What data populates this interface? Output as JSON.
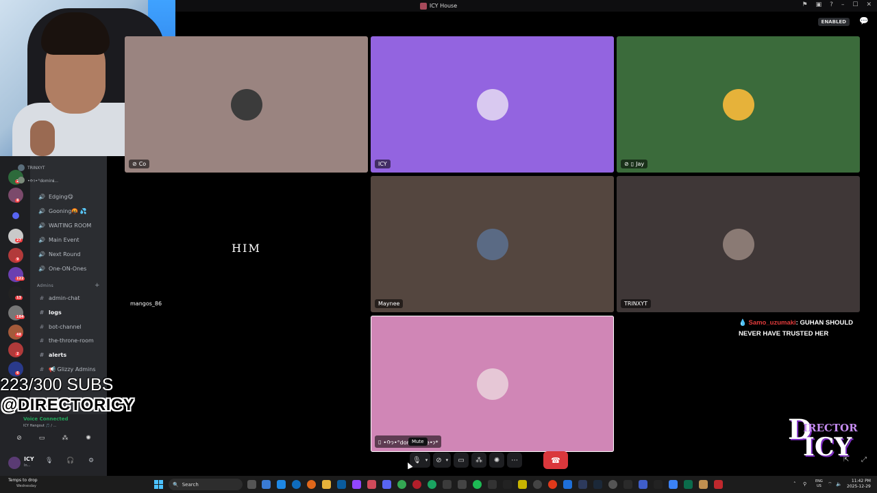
{
  "window": {
    "title": "ICY House",
    "enabled_badge": "ENABLED"
  },
  "sidebar": {
    "voice_users": [
      "TRINXYT",
      "•ᡣ𐭩•°dominℹ..."
    ],
    "channels": [
      {
        "label": "Edging😋",
        "type": "voice"
      },
      {
        "label": "Gooning🤬 💦",
        "type": "voice"
      },
      {
        "label": "WAITING ROOM",
        "type": "voice"
      },
      {
        "label": "Main Event",
        "type": "voice"
      },
      {
        "label": "Next Round",
        "type": "voice"
      },
      {
        "label": "One-ON-Ones",
        "type": "voice"
      }
    ],
    "admin_category": "Admins",
    "admin_channels": [
      {
        "label": "admin-chat",
        "bold": false
      },
      {
        "label": "logs",
        "bold": true
      },
      {
        "label": "bot-channel",
        "bold": false
      },
      {
        "label": "the-throne-room",
        "bold": false
      },
      {
        "label": "alerts",
        "bold": true
      },
      {
        "label": "📢 Glizzy Admins",
        "bold": false
      }
    ],
    "server_badges": [
      "2",
      "8",
      "27",
      "9",
      "122",
      "13",
      "184",
      "48",
      "2",
      "6"
    ],
    "voice_connected": "Voice Connected",
    "voice_location": "ICY Hangout 🎵 / ...",
    "user_name": "ICY",
    "user_status": "In..."
  },
  "overlay": {
    "subs": "223/300 SUBS",
    "handle": "@DIRECTORICY"
  },
  "tiles": [
    {
      "name": "Co",
      "bg": "#9a8480",
      "avatar": "#3b3b3b",
      "icon": "mic-muted"
    },
    {
      "name": "ICY",
      "bg": "#9364e0",
      "avatar": "#d9c9f0"
    },
    {
      "name": "Jay",
      "bg": "#3b6b3b",
      "avatar": "#e6b23a",
      "icon": "mic-muted-mobile"
    },
    {
      "name": "mangos_86",
      "bg": "#000000",
      "video_text": "HIM"
    },
    {
      "name": "Maynee",
      "bg": "#54463f",
      "avatar": "#5a6a84"
    },
    {
      "name": "TRINXYT",
      "bg": "#3f3737",
      "avatar": "#8a7a74"
    },
    {
      "name": "•ᡣ𐭩•°dominℹque•𐭩*",
      "bg": "#d086b6",
      "avatar": "#e6c7d6",
      "icon": "mobile"
    }
  ],
  "chat": {
    "username": "Samo_uzumaki",
    "message": ": GUHAN SHOULD NEVER HAVE TRUSTED HER"
  },
  "controls": {
    "tooltip": "Mute"
  },
  "logo": {
    "top": "IRECTOR",
    "bottom": "ICY",
    "d": "D"
  },
  "taskbar": {
    "weather": "Temps to drop",
    "weather_sub": "Wednesday",
    "search": "Search",
    "lang_top": "ENG",
    "lang_bottom": "US",
    "time": "11:42 PM",
    "date": "2025-12-29"
  },
  "colors": {
    "hangup": "#da373c",
    "accent": "#5865f2",
    "chat_name": "#e23b3b"
  }
}
